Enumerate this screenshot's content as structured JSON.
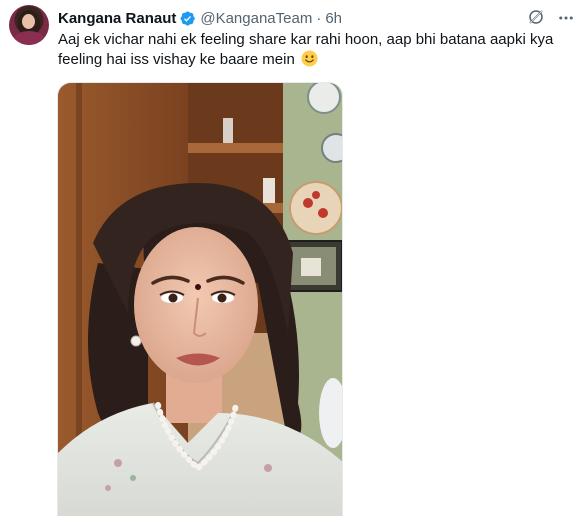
{
  "tweet": {
    "author": {
      "display_name": "Kangana Ranaut",
      "handle": "@KanganaTeam",
      "separator": "·",
      "time": "6h",
      "avatar_icon": "avatar-photo",
      "verified_icon": "verified-badge-icon",
      "verified_color": "#1d9bf0"
    },
    "text": "Aaj ek vichar nahi ek feeling share kar rahi hoon, aap bhi batana aapki kya feeling hai iss vishay ke baare mein",
    "emoji": "slightly-smiling-face",
    "actions": {
      "grok_icon": "grok-icon",
      "more_icon": "more-options-icon"
    },
    "media": {
      "type": "video-still",
      "description_icon": "video-thumbnail"
    }
  }
}
